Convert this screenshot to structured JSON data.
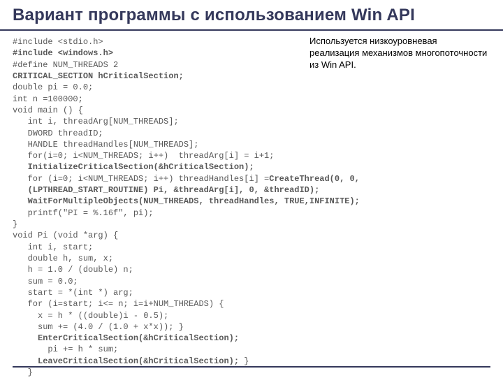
{
  "title": "Вариант программы c использованием Win API",
  "note": "Используется низкоуровневая реализация механизмов многопоточности из Win API.",
  "code": {
    "l01": "#include <stdio.h>",
    "l02": "#include <windows.h>",
    "l03": "#define NUM_THREADS 2",
    "l04": "CRITICAL_SECTION hCriticalSection;",
    "l05": "double pi = 0.0;",
    "l06": "int n =100000;",
    "l07": "void main () {",
    "l08": "   int i, threadArg[NUM_THREADS];",
    "l09": "   DWORD threadID;",
    "l10": "   HANDLE threadHandles[NUM_THREADS];",
    "l11": "   for(i=0; i<NUM_THREADS; i++)  threadArg[i] = i+1;",
    "l12": "   InitializeCriticalSection(&hCriticalSection);",
    "l13a": "   for (i=0; i<NUM_THREADS; i++) threadHandles[i] =",
    "l13b": "CreateThread(0, 0,",
    "l14": "   (LPTHREAD_START_ROUTINE) Pi, &threadArg[i], 0, &threadID);",
    "l15": "   WaitForMultipleObjects(NUM_THREADS, threadHandles, TRUE,INFINITE);",
    "l16": "   printf(\"PI = %.16f\", pi);",
    "l17": "}",
    "l18": "void Pi (void *arg) {",
    "l19": "   int i, start;",
    "l20": "   double h, sum, x;",
    "l21": "   h = 1.0 / (double) n;",
    "l22": "   sum = 0.0;",
    "l23": "   start = *(int *) arg;",
    "l24": "   for (i=start; i<= n; i=i+NUM_THREADS) {",
    "l25": "     x = h * ((double)i - 0.5);",
    "l26": "     sum += (4.0 / (1.0 + x*x)); }",
    "l27": "     EnterCriticalSection(&hCriticalSection);",
    "l28": "       pi += h * sum;",
    "l29a": "     LeaveCriticalSection(&hCriticalSection);",
    "l29b": " }",
    "l30": "   }"
  }
}
